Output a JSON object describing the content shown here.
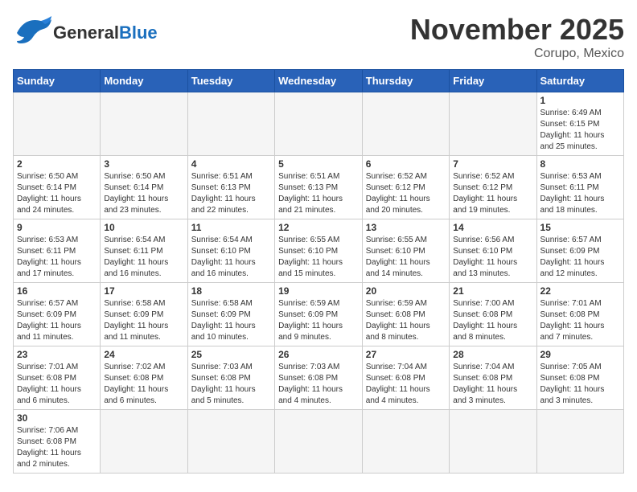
{
  "header": {
    "logo_general": "General",
    "logo_blue": "Blue",
    "month": "November 2025",
    "location": "Corupo, Mexico"
  },
  "days_of_week": [
    "Sunday",
    "Monday",
    "Tuesday",
    "Wednesday",
    "Thursday",
    "Friday",
    "Saturday"
  ],
  "weeks": [
    [
      {
        "day": "",
        "info": ""
      },
      {
        "day": "",
        "info": ""
      },
      {
        "day": "",
        "info": ""
      },
      {
        "day": "",
        "info": ""
      },
      {
        "day": "",
        "info": ""
      },
      {
        "day": "",
        "info": ""
      },
      {
        "day": "1",
        "info": "Sunrise: 6:49 AM\nSunset: 6:15 PM\nDaylight: 11 hours\nand 25 minutes."
      }
    ],
    [
      {
        "day": "2",
        "info": "Sunrise: 6:50 AM\nSunset: 6:14 PM\nDaylight: 11 hours\nand 24 minutes."
      },
      {
        "day": "3",
        "info": "Sunrise: 6:50 AM\nSunset: 6:14 PM\nDaylight: 11 hours\nand 23 minutes."
      },
      {
        "day": "4",
        "info": "Sunrise: 6:51 AM\nSunset: 6:13 PM\nDaylight: 11 hours\nand 22 minutes."
      },
      {
        "day": "5",
        "info": "Sunrise: 6:51 AM\nSunset: 6:13 PM\nDaylight: 11 hours\nand 21 minutes."
      },
      {
        "day": "6",
        "info": "Sunrise: 6:52 AM\nSunset: 6:12 PM\nDaylight: 11 hours\nand 20 minutes."
      },
      {
        "day": "7",
        "info": "Sunrise: 6:52 AM\nSunset: 6:12 PM\nDaylight: 11 hours\nand 19 minutes."
      },
      {
        "day": "8",
        "info": "Sunrise: 6:53 AM\nSunset: 6:11 PM\nDaylight: 11 hours\nand 18 minutes."
      }
    ],
    [
      {
        "day": "9",
        "info": "Sunrise: 6:53 AM\nSunset: 6:11 PM\nDaylight: 11 hours\nand 17 minutes."
      },
      {
        "day": "10",
        "info": "Sunrise: 6:54 AM\nSunset: 6:11 PM\nDaylight: 11 hours\nand 16 minutes."
      },
      {
        "day": "11",
        "info": "Sunrise: 6:54 AM\nSunset: 6:10 PM\nDaylight: 11 hours\nand 16 minutes."
      },
      {
        "day": "12",
        "info": "Sunrise: 6:55 AM\nSunset: 6:10 PM\nDaylight: 11 hours\nand 15 minutes."
      },
      {
        "day": "13",
        "info": "Sunrise: 6:55 AM\nSunset: 6:10 PM\nDaylight: 11 hours\nand 14 minutes."
      },
      {
        "day": "14",
        "info": "Sunrise: 6:56 AM\nSunset: 6:10 PM\nDaylight: 11 hours\nand 13 minutes."
      },
      {
        "day": "15",
        "info": "Sunrise: 6:57 AM\nSunset: 6:09 PM\nDaylight: 11 hours\nand 12 minutes."
      }
    ],
    [
      {
        "day": "16",
        "info": "Sunrise: 6:57 AM\nSunset: 6:09 PM\nDaylight: 11 hours\nand 11 minutes."
      },
      {
        "day": "17",
        "info": "Sunrise: 6:58 AM\nSunset: 6:09 PM\nDaylight: 11 hours\nand 11 minutes."
      },
      {
        "day": "18",
        "info": "Sunrise: 6:58 AM\nSunset: 6:09 PM\nDaylight: 11 hours\nand 10 minutes."
      },
      {
        "day": "19",
        "info": "Sunrise: 6:59 AM\nSunset: 6:09 PM\nDaylight: 11 hours\nand 9 minutes."
      },
      {
        "day": "20",
        "info": "Sunrise: 6:59 AM\nSunset: 6:08 PM\nDaylight: 11 hours\nand 8 minutes."
      },
      {
        "day": "21",
        "info": "Sunrise: 7:00 AM\nSunset: 6:08 PM\nDaylight: 11 hours\nand 8 minutes."
      },
      {
        "day": "22",
        "info": "Sunrise: 7:01 AM\nSunset: 6:08 PM\nDaylight: 11 hours\nand 7 minutes."
      }
    ],
    [
      {
        "day": "23",
        "info": "Sunrise: 7:01 AM\nSunset: 6:08 PM\nDaylight: 11 hours\nand 6 minutes."
      },
      {
        "day": "24",
        "info": "Sunrise: 7:02 AM\nSunset: 6:08 PM\nDaylight: 11 hours\nand 6 minutes."
      },
      {
        "day": "25",
        "info": "Sunrise: 7:03 AM\nSunset: 6:08 PM\nDaylight: 11 hours\nand 5 minutes."
      },
      {
        "day": "26",
        "info": "Sunrise: 7:03 AM\nSunset: 6:08 PM\nDaylight: 11 hours\nand 4 minutes."
      },
      {
        "day": "27",
        "info": "Sunrise: 7:04 AM\nSunset: 6:08 PM\nDaylight: 11 hours\nand 4 minutes."
      },
      {
        "day": "28",
        "info": "Sunrise: 7:04 AM\nSunset: 6:08 PM\nDaylight: 11 hours\nand 3 minutes."
      },
      {
        "day": "29",
        "info": "Sunrise: 7:05 AM\nSunset: 6:08 PM\nDaylight: 11 hours\nand 3 minutes."
      }
    ],
    [
      {
        "day": "30",
        "info": "Sunrise: 7:06 AM\nSunset: 6:08 PM\nDaylight: 11 hours\nand 2 minutes."
      },
      {
        "day": "",
        "info": ""
      },
      {
        "day": "",
        "info": ""
      },
      {
        "day": "",
        "info": ""
      },
      {
        "day": "",
        "info": ""
      },
      {
        "day": "",
        "info": ""
      },
      {
        "day": "",
        "info": ""
      }
    ]
  ]
}
